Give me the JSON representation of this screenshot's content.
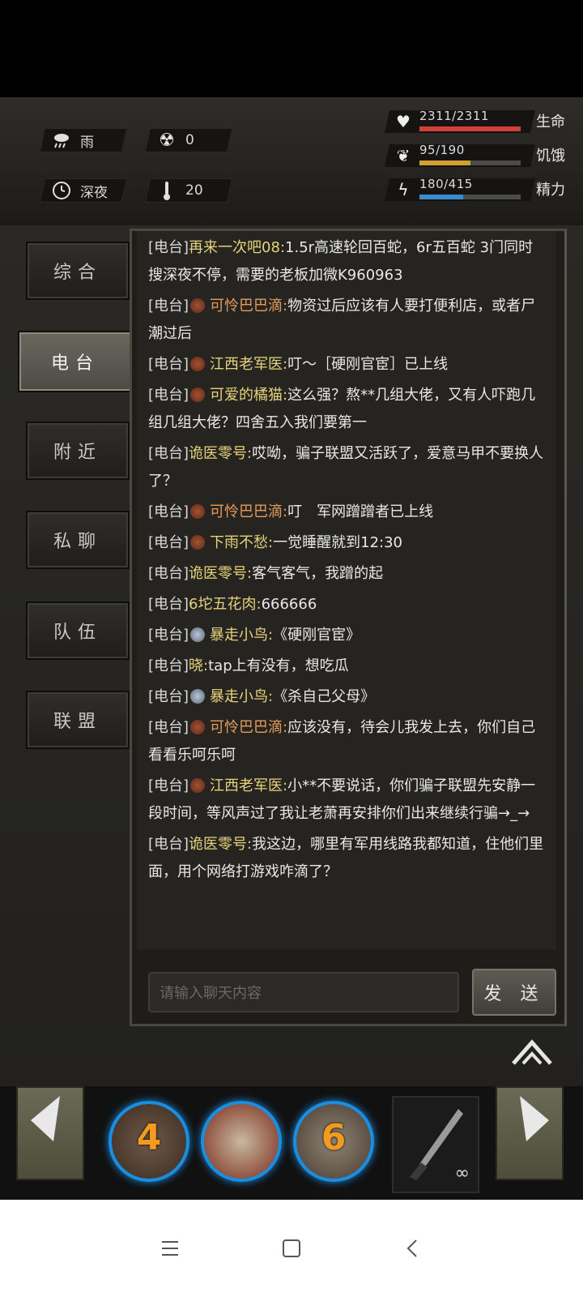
{
  "hud": {
    "weather": "雨",
    "radiation": "0",
    "time_of_day": "深夜",
    "temperature": "20",
    "stats": [
      {
        "value": "2311/2311",
        "label": "生命",
        "fill": 1.0,
        "color": "#d2403a"
      },
      {
        "value": "95/190",
        "label": "饥饿",
        "fill": 0.5,
        "color": "#d0a030"
      },
      {
        "value": "180/415",
        "label": "精力",
        "fill": 0.4337,
        "color": "#3a8ad0"
      }
    ]
  },
  "sidebar": {
    "tabs": [
      "综合",
      "电台",
      "附近",
      "私聊",
      "队伍",
      "联盟"
    ],
    "active": "电台"
  },
  "chat": {
    "messages": [
      {
        "chan": "[电台]",
        "badge": "",
        "name": "再来一次吧08:",
        "name_color": "yellow",
        "text": "1.5r高速轮回百蛇，6r五百蛇 3门同时搜深夜不停，需要的老板加微K960963"
      },
      {
        "chan": "[电台]",
        "badge": "b",
        "name": "可怜巴巴滴:",
        "name_color": "orange",
        "text": "物资过后应该有人要打便利店，或者尸潮过后"
      },
      {
        "chan": "[电台]",
        "badge": "b",
        "name": "江西老军医:",
        "name_color": "yellow",
        "text": "叮～［硬刚官宦］已上线"
      },
      {
        "chan": "[电台]",
        "badge": "b",
        "name": "可爱的橘猫:",
        "name_color": "yellow",
        "text": "这么强？熬**几组大佬，又有人吓跑几组几组大佬？四舍五入我们要第一"
      },
      {
        "chan": "[电台]",
        "badge": "",
        "name": "诡医零号:",
        "name_color": "yellow",
        "text": "哎呦，骗子联盟又活跃了，爱意马甲不要换人了？"
      },
      {
        "chan": "[电台]",
        "badge": "b",
        "name": "可怜巴巴滴:",
        "name_color": "orange",
        "text": "叮　军网蹭蹭者已上线"
      },
      {
        "chan": "[电台]",
        "badge": "b",
        "name": "下雨不愁:",
        "name_color": "yellow",
        "text": "一觉睡醒就到12:30"
      },
      {
        "chan": "[电台]",
        "badge": "",
        "name": "诡医零号:",
        "name_color": "yellow",
        "text": "客气客气，我蹭的起"
      },
      {
        "chan": "[电台]",
        "badge": "",
        "name": "6坨五花肉:",
        "name_color": "yellow",
        "text": "666666"
      },
      {
        "chan": "[电台]",
        "badge": "s",
        "name": "暴走小鸟:",
        "name_color": "yellow",
        "text": "《硬刚官宦》"
      },
      {
        "chan": "[电台]",
        "badge": "",
        "name": "晓:",
        "name_color": "yellow",
        "text": "tap上有没有，想吃瓜"
      },
      {
        "chan": "[电台]",
        "badge": "s",
        "name": "暴走小鸟:",
        "name_color": "yellow",
        "text": "《杀自己父母》"
      },
      {
        "chan": "[电台]",
        "badge": "b",
        "name": "可怜巴巴滴:",
        "name_color": "orange",
        "text": "应该没有，待会儿我发上去，你们自己看看乐呵乐呵"
      },
      {
        "chan": "[电台]",
        "badge": "b",
        "name": "江西老军医:",
        "name_color": "yellow",
        "text": "小**不要说话，你们骗子联盟先安静一段时间，等风声过了我让老萧再安排你们出来继续行骗→_→"
      },
      {
        "chan": "[电台]",
        "badge": "",
        "name": "诡医零号:",
        "name_color": "yellow",
        "text": "我这边，哪里有军用线路我都知道，住他们里面，用个网络打游戏咋滴了？"
      }
    ],
    "input_placeholder": "请输入聊天内容",
    "send_label": "发 送"
  },
  "hotbar": {
    "skills": [
      "4",
      "",
      "6"
    ],
    "weapon_count": "∞"
  },
  "colors": {
    "accent_blue": "#1a8ee0",
    "skill_number": "#f39a1f"
  }
}
